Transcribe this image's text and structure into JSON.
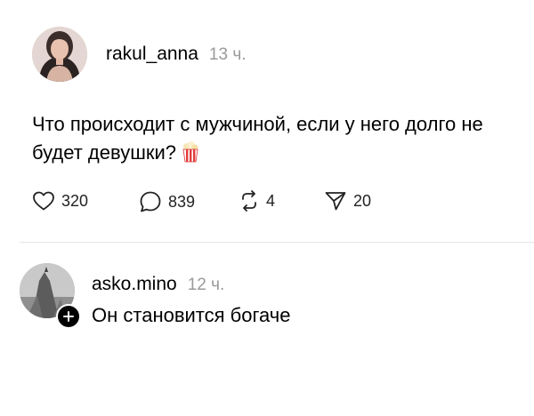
{
  "post": {
    "username": "rakul_anna",
    "time": "13 ч.",
    "text": "Что происходит с мужчиной, если у него долго не будет девушки?",
    "emoji_icon": "popcorn-icon",
    "actions": {
      "likes": "320",
      "comments": "839",
      "reposts": "4",
      "shares": "20"
    }
  },
  "reply": {
    "username": "asko.mino",
    "time": "12 ч.",
    "text": "Он становится богаче"
  }
}
